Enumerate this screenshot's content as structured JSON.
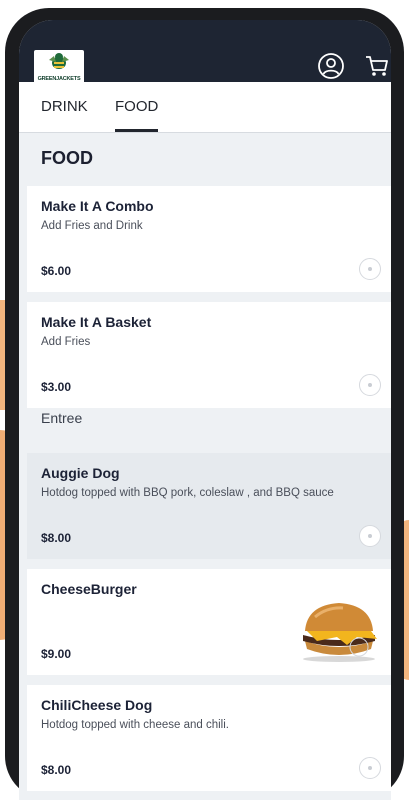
{
  "header": {
    "logo_text": "GREENJACKETS",
    "profile_icon": "user-icon",
    "cart_icon": "cart-icon"
  },
  "tabs": [
    {
      "label": "DRINK",
      "active": false
    },
    {
      "label": "FOOD",
      "active": true
    }
  ],
  "section_title": "FOOD",
  "items": [
    {
      "name": "Make It A Combo",
      "description": "Add Fries and Drink",
      "price": "$6.00"
    },
    {
      "name": "Make It A Basket",
      "description": "Add Fries",
      "price": "$3.00"
    }
  ],
  "group_title": "Entree",
  "entree_items": [
    {
      "name": "Auggie Dog",
      "description": "Hotdog topped with BBQ pork, coleslaw , and BBQ sauce",
      "price": "$8.00",
      "highlighted": true
    },
    {
      "name": "CheeseBurger",
      "description": "",
      "price": "$9.00",
      "image": "cheeseburger-photo"
    },
    {
      "name": "ChiliCheese Dog",
      "description": "Hotdog topped with cheese and chili.",
      "price": "$8.00"
    }
  ],
  "colors": {
    "appbar": "#1e2533",
    "page_bg": "#eef1f4",
    "text_dark": "#1c2236",
    "hand": "#f3b67f"
  }
}
